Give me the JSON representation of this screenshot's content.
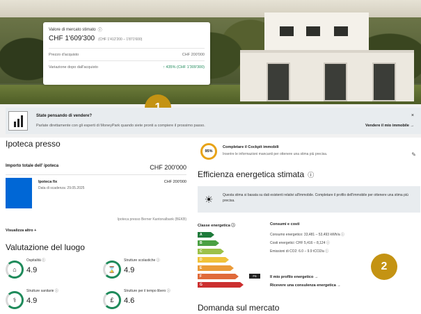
{
  "valuation": {
    "label": "Valore di mercato stimato",
    "value": "CHF 1'609'300",
    "range": "(CHF 1'412'200 – 1'871'600)",
    "purchase_label": "Prezzo d'acquisto",
    "purchase_value": "CHF 200'000",
    "change_label": "Variazione dopo dall'acquisto",
    "change_value": "↑ 435% (CHF 1'309'300)"
  },
  "markers": [
    "1",
    "2"
  ],
  "sell_banner": {
    "title": "State pensando di vendere?",
    "text": "Parlate direttamente con gli esperti di MoneyPark quando siete pronti a compiere il prossimo passo.",
    "cta": "Vendere il mio immobile →",
    "close": "×"
  },
  "mortgage": {
    "title": "Ipoteca presso",
    "total_label": "Importo totale dell' ipoteca",
    "total_value": "CHF 200'000",
    "product": "Ipoteca fix",
    "due": "Data di scadenza: 29.05.2025",
    "product_value": "CHF 200'000",
    "bank_note": "Ipoteca presso Berner Kantonalbank (BEKB)",
    "show_more": "Visualizza altro  +"
  },
  "location": {
    "title": "Valutazione del luogo",
    "ratings": [
      {
        "label": "Ospitalità",
        "score": "4.9",
        "icon": "⌂"
      },
      {
        "label": "Strutture scolastiche",
        "score": "4.9",
        "icon": "⌛"
      },
      {
        "label": "Strutture sanitarie",
        "score": "4.9",
        "icon": "⚕"
      },
      {
        "label": "Strutture per il tempo libero",
        "score": "4.6",
        "icon": "£"
      }
    ]
  },
  "cockpit": {
    "percent": "95%",
    "title": "Completare il Cockpit immobili",
    "subtitle": "Inserire le informazioni mancanti per ottenere una stima più precisa.",
    "edit_icon": "✎"
  },
  "energy": {
    "title": "Efficienza energetica stimata",
    "banner_icon": "☀",
    "banner_text": "Questa stima si basata su dati esistenti relativi all'immobile. Completare il profilo dell'immobile per ottenere una stima più precisa.",
    "class_label": "Classe energetica",
    "classes": [
      "A",
      "B",
      "C",
      "D",
      "E",
      "F",
      "G"
    ],
    "class_colors": [
      "#1e7a3a",
      "#4aa043",
      "#9cc149",
      "#f0c23a",
      "#eb9b38",
      "#e06a3a",
      "#cc2f2f"
    ],
    "selected_tag": "F6",
    "consumption_title": "Consumi e costi",
    "consumption": "Consumo energetico: 33,481 – 53,493 kWh/a",
    "costs": "Costi energetici: CHF 5,416 – 8,124",
    "emissions": "Emissioni di CO2: 6.0 – 9.9 tCO2/a",
    "link1": "Il mio profilo energetico  →",
    "link2": "Ricevere una consulenza energetica  →"
  },
  "demand": {
    "title": "Domanda sul mercato"
  }
}
